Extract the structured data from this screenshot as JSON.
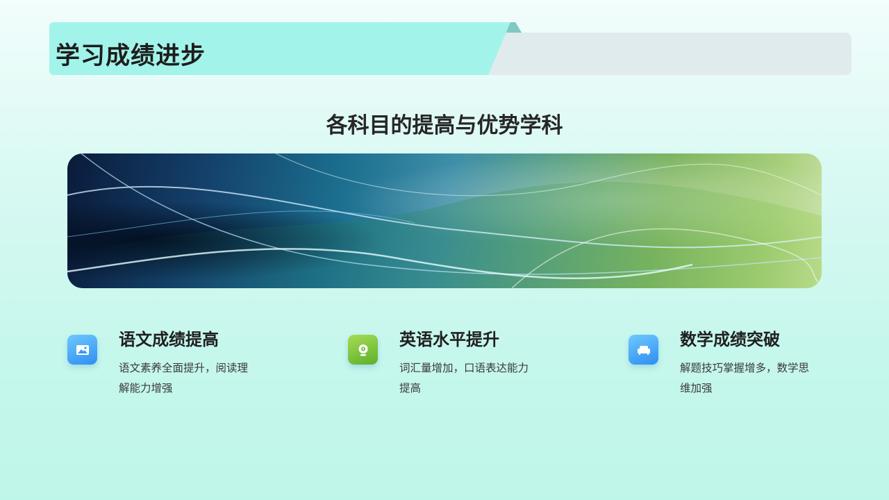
{
  "header": {
    "title": "学习成绩进步"
  },
  "section": {
    "heading": "各科目的提高与优势学科"
  },
  "banner": {
    "image": "abstract-wave-image"
  },
  "features": [
    {
      "icon": "image-icon",
      "title": "语文成绩提高",
      "description": "语文素养全面提升，阅读理解能力增强"
    },
    {
      "icon": "webcam-icon",
      "title": "英语水平提升",
      "description": "词汇量增加，口语表达能力提高"
    },
    {
      "icon": "sofa-icon",
      "title": "数学成绩突破",
      "description": "解题技巧掌握增多，数学思维加强"
    }
  ],
  "colors": {
    "header_accent": "#a2f4ea",
    "header_bar": "#e0ebee",
    "icon_blue": "#3a98f2",
    "icon_green": "#6fbd34",
    "background": "#c6f7ec"
  }
}
